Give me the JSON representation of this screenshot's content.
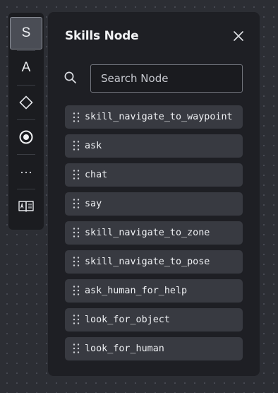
{
  "toolbar": {
    "tools": [
      {
        "label": "S",
        "icon": "letter-s",
        "active": true
      },
      {
        "label": "A",
        "icon": "letter-a",
        "active": false
      },
      {
        "label": "",
        "icon": "diamond-icon",
        "active": false
      },
      {
        "label": "",
        "icon": "radio-dot-icon",
        "active": false
      },
      {
        "label": "···",
        "icon": "ellipsis-icon",
        "active": false
      },
      {
        "label": "",
        "icon": "book-icon",
        "active": false
      }
    ]
  },
  "panel": {
    "title": "Skills Node",
    "close_icon": "close-icon",
    "search": {
      "placeholder": "Search Node",
      "value": "",
      "icon": "search-icon"
    },
    "nodes": [
      {
        "label": "skill_navigate_to_waypoint"
      },
      {
        "label": "ask"
      },
      {
        "label": "chat"
      },
      {
        "label": "say"
      },
      {
        "label": "skill_navigate_to_zone"
      },
      {
        "label": "skill_navigate_to_pose"
      },
      {
        "label": "ask_human_for_help"
      },
      {
        "label": "look_for_object"
      },
      {
        "label": "look_for_human"
      }
    ]
  },
  "colors": {
    "canvas": "#2c2e34",
    "panel": "#1e1f24",
    "node_item": "#383a41",
    "active_tool": "#4a4d55",
    "text": "#eef0f3"
  }
}
